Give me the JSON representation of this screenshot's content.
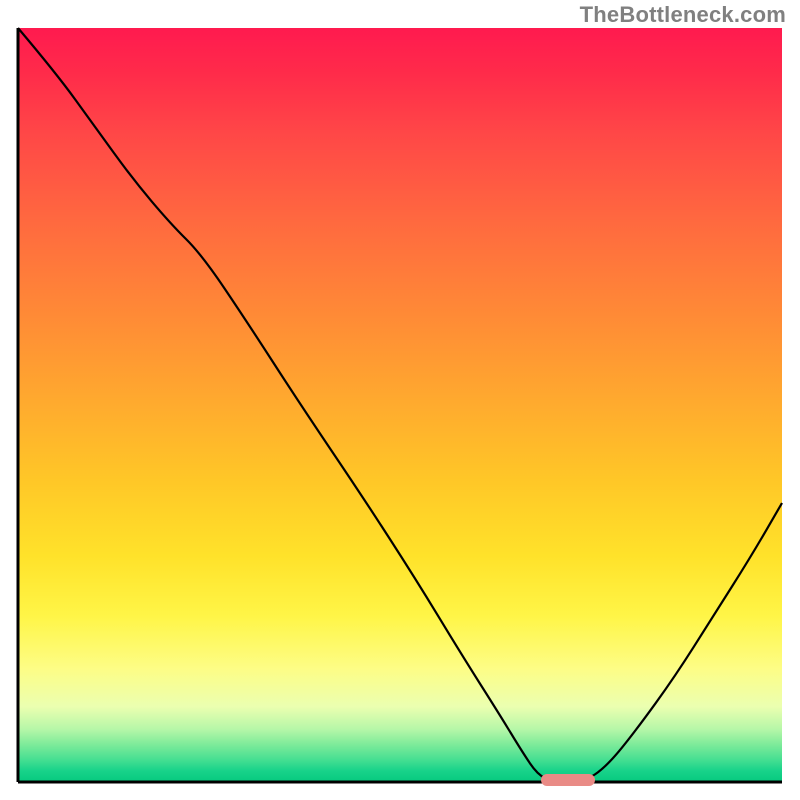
{
  "watermark": "TheBottleneck.com",
  "chart_data": {
    "type": "line",
    "title": "",
    "xlabel": "",
    "ylabel": "",
    "xlim": [
      0,
      1
    ],
    "ylim": [
      0,
      1
    ],
    "legend": false,
    "grid": false,
    "background": "vertical-cost-gradient (red=high → green=low)",
    "series": [
      {
        "name": "cost-curve",
        "x": [
          0.0,
          0.05,
          0.1,
          0.15,
          0.2,
          0.24,
          0.3,
          0.37,
          0.45,
          0.52,
          0.58,
          0.63,
          0.66,
          0.68,
          0.7,
          0.72,
          0.74,
          0.77,
          0.81,
          0.86,
          0.91,
          0.96,
          1.0
        ],
        "y": [
          1.0,
          0.94,
          0.87,
          0.8,
          0.74,
          0.7,
          0.61,
          0.5,
          0.38,
          0.27,
          0.17,
          0.09,
          0.04,
          0.01,
          0.0,
          0.0,
          0.0,
          0.02,
          0.07,
          0.14,
          0.22,
          0.3,
          0.37
        ]
      }
    ],
    "annotations": [
      {
        "name": "optimal-marker",
        "shape": "rounded-bar",
        "color": "#e98b86",
        "x_range": [
          0.685,
          0.755
        ],
        "y": 0.0
      }
    ]
  }
}
